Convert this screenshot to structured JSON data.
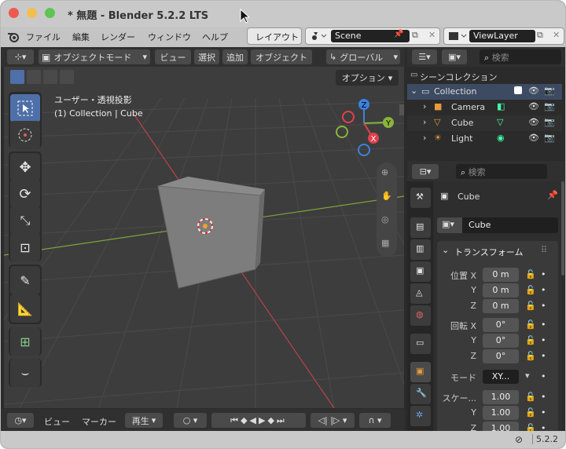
{
  "window": {
    "title": "* 無題 - Blender 5.2.2 LTS"
  },
  "menu": {
    "items": [
      "ファイル",
      "編集",
      "レンダー",
      "ウィンドウ",
      "ヘルプ"
    ],
    "workspace_tab": "レイアウト",
    "scene": "Scene",
    "view_layer": "ViewLayer"
  },
  "viewport": {
    "mode": "オブジェクトモード",
    "menus": [
      "ビュー",
      "選択",
      "追加",
      "オブジェクト"
    ],
    "transform": "グローバル",
    "options": "オプション",
    "info_line1": "ユーザー・透視投影",
    "info_line2": "(1) Collection | Cube",
    "gizmo": {
      "x": "X",
      "y": "Y",
      "z": "Z"
    }
  },
  "outliner": {
    "search_placeholder": "検索",
    "root": "シーンコレクション",
    "collection": "Collection",
    "items": [
      {
        "name": "Camera"
      },
      {
        "name": "Cube"
      },
      {
        "name": "Light"
      }
    ]
  },
  "properties": {
    "search_placeholder": "検索",
    "object_name": "Cube",
    "object_field": "Cube",
    "panel_title": "トランスフォーム",
    "location_label": "位置 X",
    "location": [
      "0 m",
      "0 m",
      "0 m"
    ],
    "rotation_label": "回転 X",
    "rotation": [
      "0°",
      "0°",
      "0°"
    ],
    "axis_y": "Y",
    "axis_z": "Z",
    "mode_label": "モード",
    "mode_value": "XY...",
    "scale_label": "スケー...",
    "scale": [
      "1.00",
      "1.00",
      "1.00"
    ]
  },
  "timeline": {
    "view": "ビュー",
    "marker": "マーカー",
    "playback": "再生"
  },
  "status": {
    "version": "5.2.2"
  },
  "colors": {
    "accent": "#4772b3",
    "x_axis": "#e0414e",
    "y_axis": "#8ab43a",
    "z_axis": "#3c82de"
  }
}
